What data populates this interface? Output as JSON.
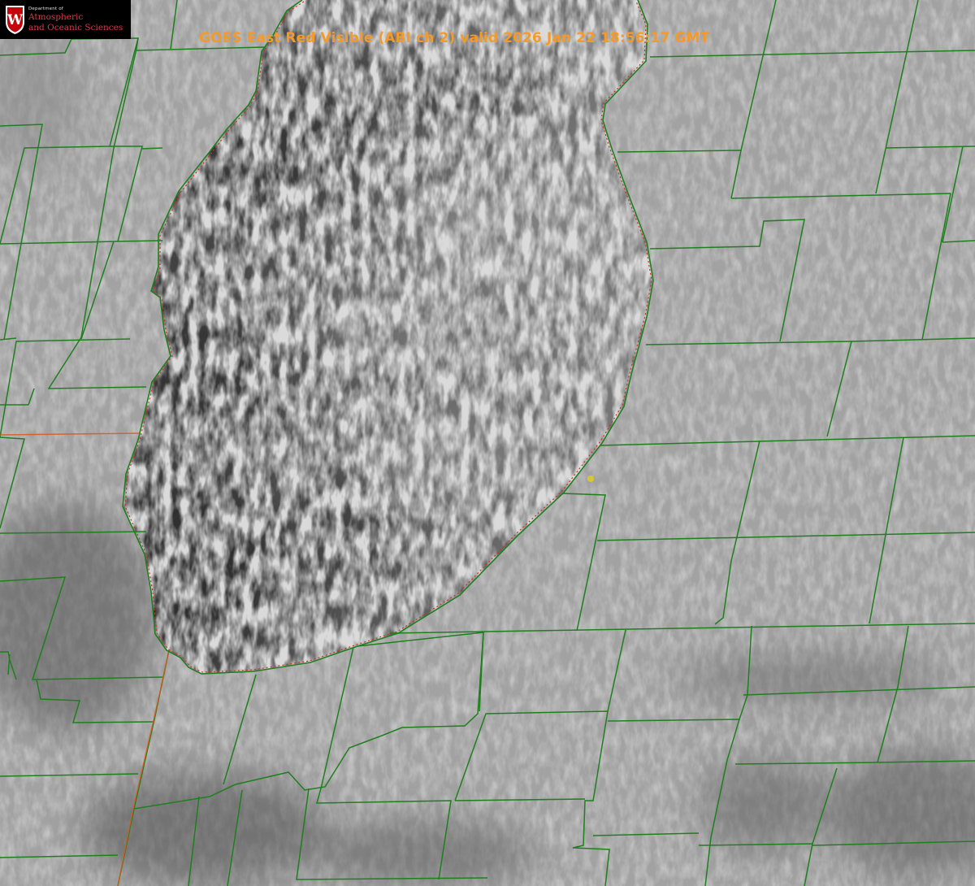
{
  "title": "GOES East Red Visible (ABI ch 2) valid 2026 Jan 22 18:56:17 GMT",
  "logo": {
    "department_line": "Department of",
    "name_line1": "Atmospheric",
    "name_line2": "and Oceanic Sciences",
    "shield_letter": "W"
  },
  "colors": {
    "title": "#f39a2a",
    "boundary_lines": "#1f7f1f",
    "state_line": "#d9581a",
    "shoreline_dots": "#d42a2a",
    "marker": "#d6c833",
    "logo_red": "#c5050c",
    "cloud_land": "#a4a4a4",
    "lake": "#4b4b4b"
  },
  "features": {
    "water_body": "lake",
    "location_marker": "yellow-dot",
    "overlay": "county-boundaries"
  }
}
